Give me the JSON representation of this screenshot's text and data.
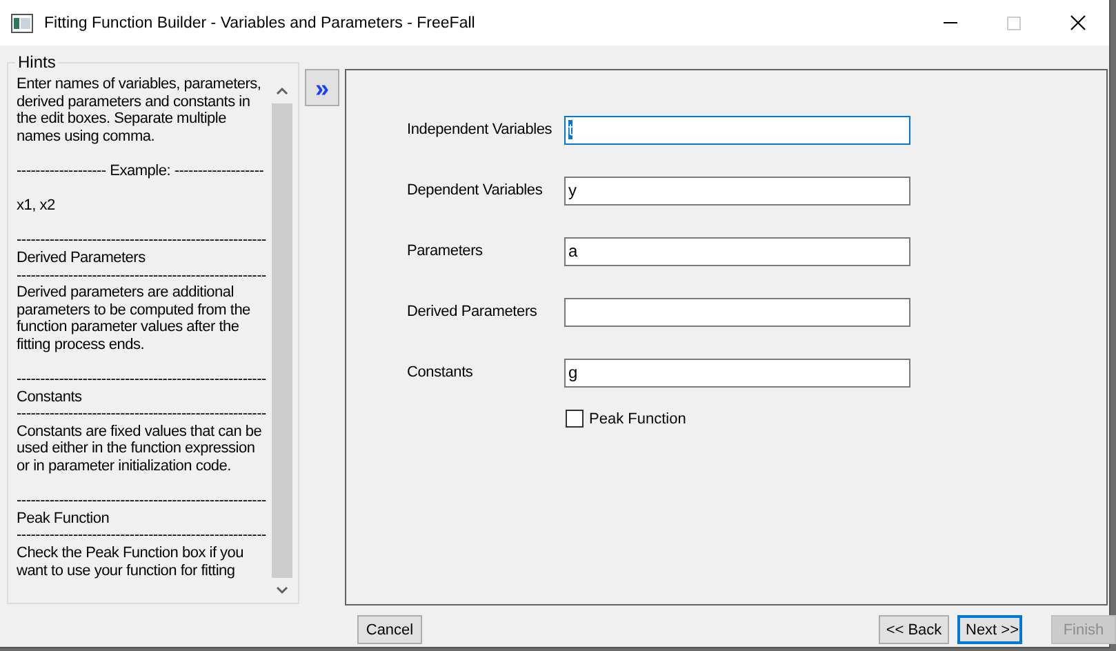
{
  "window": {
    "title": "Fitting Function Builder - Variables and Parameters - FreeFall"
  },
  "hints": {
    "title": "Hints",
    "items": [
      {
        "kind": "paragraph",
        "text": "Enter names of variables, parameters, derived parameters and constants in the edit boxes. Separate multiple names using comma."
      },
      {
        "kind": "paragraph",
        "text": "------------------- Example: -------------------"
      },
      {
        "kind": "paragraph",
        "text": "x1, x2"
      },
      {
        "kind": "line",
        "text": "-----------------------------------------------------"
      },
      {
        "kind": "line",
        "text": "Derived Parameters"
      },
      {
        "kind": "line",
        "text": "-----------------------------------------------------"
      },
      {
        "kind": "paragraph",
        "text": "Derived parameters are additional parameters to be computed from the function parameter values after the fitting process ends."
      },
      {
        "kind": "line",
        "text": "-----------------------------------------------------"
      },
      {
        "kind": "line",
        "text": "Constants"
      },
      {
        "kind": "line",
        "text": "-----------------------------------------------------"
      },
      {
        "kind": "paragraph",
        "text": "Constants are fixed values that can be used either in the function expression or in parameter initialization code."
      },
      {
        "kind": "line",
        "text": "-----------------------------------------------------"
      },
      {
        "kind": "line",
        "text": "Peak Function"
      },
      {
        "kind": "line",
        "text": "-----------------------------------------------------"
      },
      {
        "kind": "paragraph",
        "text": "Check the Peak Function box if you want to use your function for fitting"
      }
    ]
  },
  "toggle": {
    "label": "»"
  },
  "fields": [
    {
      "label": "Independent Variables",
      "value": "t",
      "focused": true
    },
    {
      "label": "Dependent Variables",
      "value": "y",
      "focused": false
    },
    {
      "label": "Parameters",
      "value": "a",
      "focused": false
    },
    {
      "label": "Derived Parameters",
      "focused": false
    },
    {
      "label": "Constants",
      "value": "g",
      "focused": false
    }
  ],
  "peak_function": {
    "label": "Peak Function",
    "checked": false
  },
  "buttons": [
    {
      "label": "Cancel",
      "default": false,
      "disabled": false
    },
    {
      "label": "<< Back",
      "default": false,
      "disabled": false
    },
    {
      "label": "Next >>",
      "default": true,
      "disabled": false
    },
    {
      "label": "Finish",
      "default": false,
      "disabled": true
    }
  ]
}
